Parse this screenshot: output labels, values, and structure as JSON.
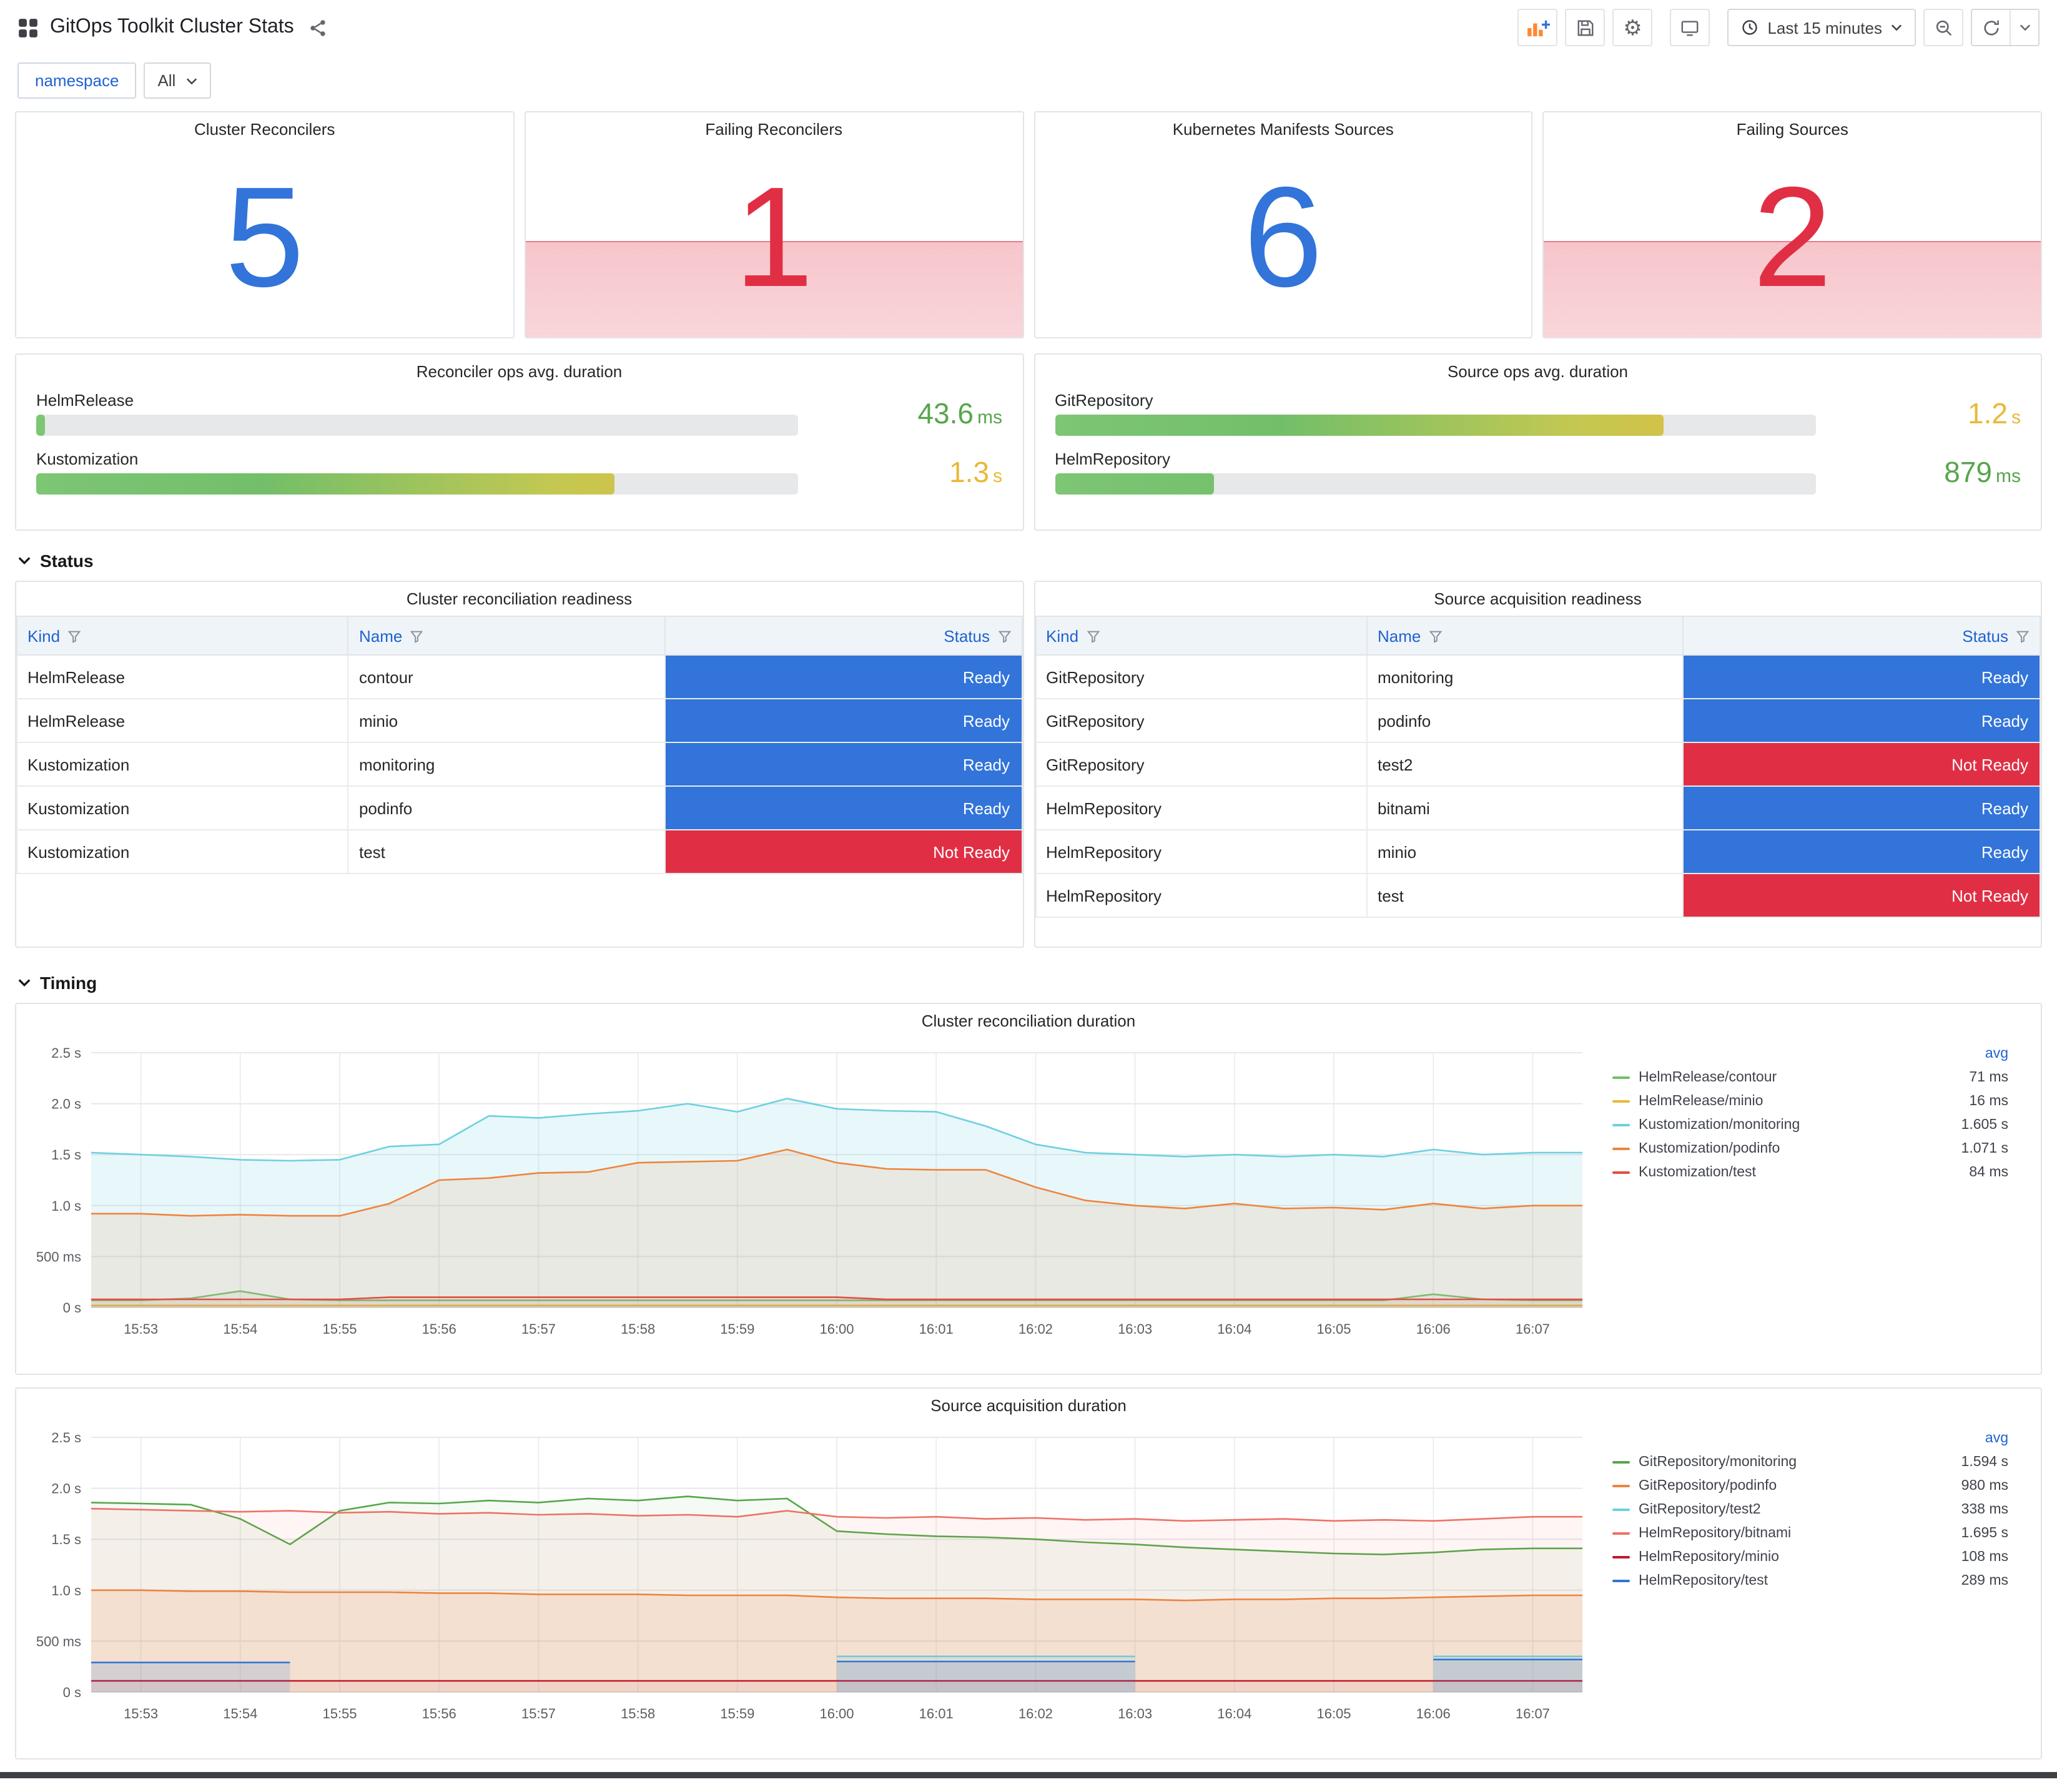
{
  "header": {
    "title": "GitOps Toolkit Cluster Stats"
  },
  "toolbar": {
    "time_range_label": "Last 15 minutes"
  },
  "variables": {
    "label": "namespace",
    "value": "All"
  },
  "sections": {
    "status": "Status",
    "timing": "Timing"
  },
  "icons": {
    "gear": "⚙"
  },
  "stat_panels": [
    {
      "title": "Cluster Reconcilers",
      "value": "5",
      "color": "#3274D9",
      "alert": false
    },
    {
      "title": "Failing Reconcilers",
      "value": "1",
      "color": "#E02F44",
      "alert": true
    },
    {
      "title": "Kubernetes Manifests Sources",
      "value": "6",
      "color": "#3274D9",
      "alert": false
    },
    {
      "title": "Failing Sources",
      "value": "2",
      "color": "#E02F44",
      "alert": true
    }
  ],
  "gauge_panels": [
    {
      "title": "Reconciler ops avg. duration",
      "bars": [
        {
          "label": "HelmRelease",
          "value": "43.6",
          "unit": "ms",
          "percent": 1.2,
          "value_color": "#56A64B"
        },
        {
          "label": "Kustomization",
          "value": "1.3",
          "unit": "s",
          "percent": 76,
          "value_color": "#EAB839"
        }
      ]
    },
    {
      "title": "Source ops avg. duration",
      "bars": [
        {
          "label": "GitRepository",
          "value": "1.2",
          "unit": "s",
          "percent": 80,
          "value_color": "#EAB839"
        },
        {
          "label": "HelmRepository",
          "value": "879",
          "unit": "ms",
          "percent": 21,
          "value_color": "#56A64B"
        }
      ]
    }
  ],
  "status_colors": {
    "Ready": "#3274D9",
    "Not Ready": "#E02F44"
  },
  "tables": [
    {
      "title": "Cluster reconciliation readiness",
      "columns": [
        "Kind",
        "Name",
        "Status"
      ],
      "rows": [
        {
          "kind": "HelmRelease",
          "name": "contour",
          "status": "Ready"
        },
        {
          "kind": "HelmRelease",
          "name": "minio",
          "status": "Ready"
        },
        {
          "kind": "Kustomization",
          "name": "monitoring",
          "status": "Ready"
        },
        {
          "kind": "Kustomization",
          "name": "podinfo",
          "status": "Ready"
        },
        {
          "kind": "Kustomization",
          "name": "test",
          "status": "Not Ready"
        }
      ]
    },
    {
      "title": "Source acquisition readiness",
      "columns": [
        "Kind",
        "Name",
        "Status"
      ],
      "rows": [
        {
          "kind": "GitRepository",
          "name": "monitoring",
          "status": "Ready"
        },
        {
          "kind": "GitRepository",
          "name": "podinfo",
          "status": "Ready"
        },
        {
          "kind": "GitRepository",
          "name": "test2",
          "status": "Not Ready"
        },
        {
          "kind": "HelmRepository",
          "name": "bitnami",
          "status": "Ready"
        },
        {
          "kind": "HelmRepository",
          "name": "minio",
          "status": "Ready"
        },
        {
          "kind": "HelmRepository",
          "name": "test",
          "status": "Not Ready"
        }
      ]
    }
  ],
  "chart_data": [
    {
      "type": "line",
      "title": "Cluster reconciliation duration",
      "legend_header": "avg",
      "legend_position": "right",
      "grid": true,
      "ylim": [
        0,
        2.5
      ],
      "y_ticks": [
        "0 s",
        "500 ms",
        "1.0 s",
        "1.5 s",
        "2.0 s",
        "2.5 s"
      ],
      "y_tick_values": [
        0,
        0.5,
        1,
        1.5,
        2,
        2.5
      ],
      "x_ticks": [
        "15:53",
        "15:54",
        "15:55",
        "15:56",
        "15:57",
        "15:58",
        "15:59",
        "16:00",
        "16:01",
        "16:02",
        "16:03",
        "16:04",
        "16:05",
        "16:06",
        "16:07"
      ],
      "series": [
        {
          "name": "HelmRelease/contour",
          "avg": "71 ms",
          "color": "#73BF69",
          "fill": 0.08,
          "values": [
            0.07,
            0.07,
            0.09,
            0.16,
            0.08,
            0.07,
            0.07,
            0.07,
            0.07,
            0.07,
            0.07,
            0.07,
            0.07,
            0.07,
            0.07,
            0.07,
            0.07,
            0.07,
            0.07,
            0.07,
            0.07,
            0.07,
            0.07,
            0.07,
            0.07,
            0.07,
            0.07,
            0.13,
            0.08,
            0.07,
            0.07
          ]
        },
        {
          "name": "HelmRelease/minio",
          "avg": "16 ms",
          "color": "#EAB839",
          "fill": 0.08,
          "values": [
            0.02,
            0.02,
            0.02,
            0.02,
            0.02,
            0.02,
            0.02,
            0.02,
            0.02,
            0.02,
            0.02,
            0.02,
            0.02,
            0.02,
            0.02,
            0.02,
            0.02,
            0.02,
            0.02,
            0.02,
            0.02,
            0.02,
            0.02,
            0.02,
            0.02,
            0.02,
            0.02,
            0.02,
            0.02,
            0.02,
            0.02
          ]
        },
        {
          "name": "Kustomization/monitoring",
          "avg": "1.605 s",
          "color": "#6ED0E0",
          "fill": 0.16,
          "values": [
            1.52,
            1.5,
            1.48,
            1.45,
            1.44,
            1.45,
            1.58,
            1.6,
            1.88,
            1.86,
            1.9,
            1.93,
            2.0,
            1.92,
            2.05,
            1.95,
            1.93,
            1.92,
            1.78,
            1.6,
            1.52,
            1.5,
            1.48,
            1.5,
            1.48,
            1.5,
            1.48,
            1.55,
            1.5,
            1.52,
            1.52
          ]
        },
        {
          "name": "Kustomization/podinfo",
          "avg": "1.071 s",
          "color": "#EF843C",
          "fill": 0.12,
          "values": [
            0.92,
            0.92,
            0.9,
            0.91,
            0.9,
            0.9,
            1.02,
            1.25,
            1.27,
            1.32,
            1.33,
            1.42,
            1.43,
            1.44,
            1.55,
            1.42,
            1.36,
            1.35,
            1.35,
            1.18,
            1.05,
            1.0,
            0.97,
            1.02,
            0.97,
            0.98,
            0.96,
            1.02,
            0.97,
            1.0,
            1.0
          ]
        },
        {
          "name": "Kustomization/test",
          "avg": "84 ms",
          "color": "#E24D42",
          "fill": 0.08,
          "values": [
            0.08,
            0.08,
            0.08,
            0.08,
            0.08,
            0.08,
            0.1,
            0.1,
            0.1,
            0.1,
            0.1,
            0.1,
            0.1,
            0.1,
            0.1,
            0.1,
            0.08,
            0.08,
            0.08,
            0.08,
            0.08,
            0.08,
            0.08,
            0.08,
            0.08,
            0.08,
            0.08,
            0.08,
            0.08,
            0.08,
            0.08
          ]
        }
      ]
    },
    {
      "type": "line",
      "title": "Source acquisition duration",
      "legend_header": "avg",
      "legend_position": "right",
      "grid": true,
      "ylim": [
        0,
        2.5
      ],
      "y_ticks": [
        "0 s",
        "500 ms",
        "1.0 s",
        "1.5 s",
        "2.0 s",
        "2.5 s"
      ],
      "y_tick_values": [
        0,
        0.5,
        1,
        1.5,
        2,
        2.5
      ],
      "x_ticks": [
        "15:53",
        "15:54",
        "15:55",
        "15:56",
        "15:57",
        "15:58",
        "15:59",
        "16:00",
        "16:01",
        "16:02",
        "16:03",
        "16:04",
        "16:05",
        "16:06",
        "16:07"
      ],
      "series": [
        {
          "name": "GitRepository/monitoring",
          "avg": "1.594 s",
          "color": "#56A64B",
          "fill": 0.06,
          "values": [
            1.86,
            1.85,
            1.84,
            1.7,
            1.45,
            1.78,
            1.86,
            1.85,
            1.88,
            1.86,
            1.9,
            1.88,
            1.92,
            1.88,
            1.9,
            1.58,
            1.55,
            1.53,
            1.52,
            1.5,
            1.47,
            1.45,
            1.42,
            1.4,
            1.38,
            1.36,
            1.35,
            1.37,
            1.4,
            1.41,
            1.41
          ]
        },
        {
          "name": "GitRepository/podinfo",
          "avg": "980 ms",
          "color": "#EF843C",
          "fill": 0.14,
          "values": [
            1.0,
            1.0,
            0.99,
            0.99,
            0.98,
            0.98,
            0.98,
            0.97,
            0.97,
            0.96,
            0.96,
            0.96,
            0.95,
            0.95,
            0.95,
            0.93,
            0.92,
            0.92,
            0.92,
            0.91,
            0.91,
            0.91,
            0.9,
            0.91,
            0.91,
            0.92,
            0.92,
            0.93,
            0.94,
            0.95,
            0.95
          ]
        },
        {
          "name": "GitRepository/test2",
          "avg": "338 ms",
          "color": "#6ED0E0",
          "fill": 0.15,
          "values": [
            null,
            null,
            null,
            null,
            null,
            null,
            null,
            null,
            null,
            null,
            null,
            null,
            null,
            null,
            null,
            0.35,
            0.35,
            0.35,
            0.35,
            0.35,
            0.35,
            0.35,
            null,
            null,
            null,
            null,
            null,
            0.35,
            0.35,
            0.35,
            0.35
          ]
        },
        {
          "name": "HelmRepository/bitnami",
          "avg": "1.695 s",
          "color": "#EE7266",
          "fill": 0.07,
          "values": [
            1.8,
            1.79,
            1.78,
            1.77,
            1.78,
            1.76,
            1.77,
            1.75,
            1.76,
            1.74,
            1.75,
            1.73,
            1.74,
            1.72,
            1.78,
            1.72,
            1.71,
            1.72,
            1.7,
            1.71,
            1.69,
            1.7,
            1.68,
            1.69,
            1.7,
            1.68,
            1.69,
            1.68,
            1.7,
            1.72,
            1.72
          ]
        },
        {
          "name": "HelmRepository/minio",
          "avg": "108 ms",
          "color": "#C4162A",
          "fill": 0.05,
          "values": [
            0.11,
            0.11,
            0.11,
            0.11,
            0.11,
            0.11,
            0.11,
            0.11,
            0.11,
            0.11,
            0.11,
            0.11,
            0.11,
            0.11,
            0.11,
            0.11,
            0.11,
            0.11,
            0.11,
            0.11,
            0.11,
            0.11,
            0.11,
            0.11,
            0.11,
            0.11,
            0.11,
            0.11,
            0.11,
            0.11,
            0.11
          ]
        },
        {
          "name": "HelmRepository/test",
          "avg": "289 ms",
          "color": "#3274D9",
          "fill": 0.15,
          "values": [
            0.29,
            0.29,
            0.29,
            0.29,
            0.29,
            null,
            null,
            null,
            null,
            null,
            null,
            null,
            null,
            null,
            null,
            0.3,
            0.3,
            0.3,
            0.3,
            0.3,
            0.3,
            0.3,
            null,
            null,
            null,
            null,
            null,
            0.32,
            0.32,
            0.32,
            0.32
          ]
        }
      ]
    }
  ]
}
